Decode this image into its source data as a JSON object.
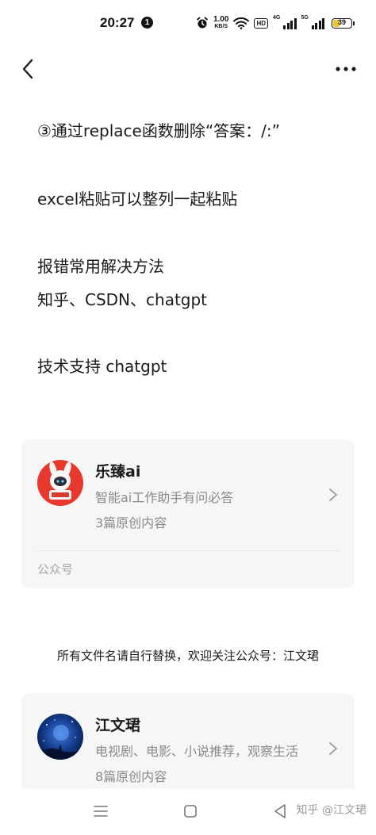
{
  "status_bar": {
    "time": "20:27",
    "notification_count": "1",
    "net_speed_value": "1.00",
    "net_speed_unit": "KB/S",
    "hd_label": "HD",
    "signal1_tag": "4G",
    "signal2_tag": "5G",
    "battery_level": "39",
    "battery_fraction": 0.39
  },
  "nav": {
    "back_icon": "chevron-left-icon",
    "more_icon": "more-dots-icon"
  },
  "article": {
    "lines": [
      "③通过replace函数删除“答案：/:”",
      "excel粘贴可以整列一起粘贴",
      "报错常用解决方法",
      "知乎、CSDN、chatgpt",
      "技术支持 chatgpt"
    ]
  },
  "card1": {
    "name": "乐臻ai",
    "desc": "智能ai工作助手有问必答",
    "count": "3篇原创内容",
    "type": "公众号",
    "avatar_bg": "#e8392f"
  },
  "notice": "所有文件名请自行替换，欢迎关注公众号：江文珺",
  "card2": {
    "name": "江文珺",
    "desc": "电视剧、电影、小说推荐，观察生活",
    "count": "8篇原创内容",
    "avatar_bg": "#0b2a6b"
  },
  "bottom_bar": {
    "watermark": "知乎 @江文珺"
  },
  "colors": {
    "card_bg": "#f6f6f6",
    "text_primary": "#1a1a1a",
    "text_secondary": "#8a8a8a",
    "battery_fill": "#f2c230"
  }
}
